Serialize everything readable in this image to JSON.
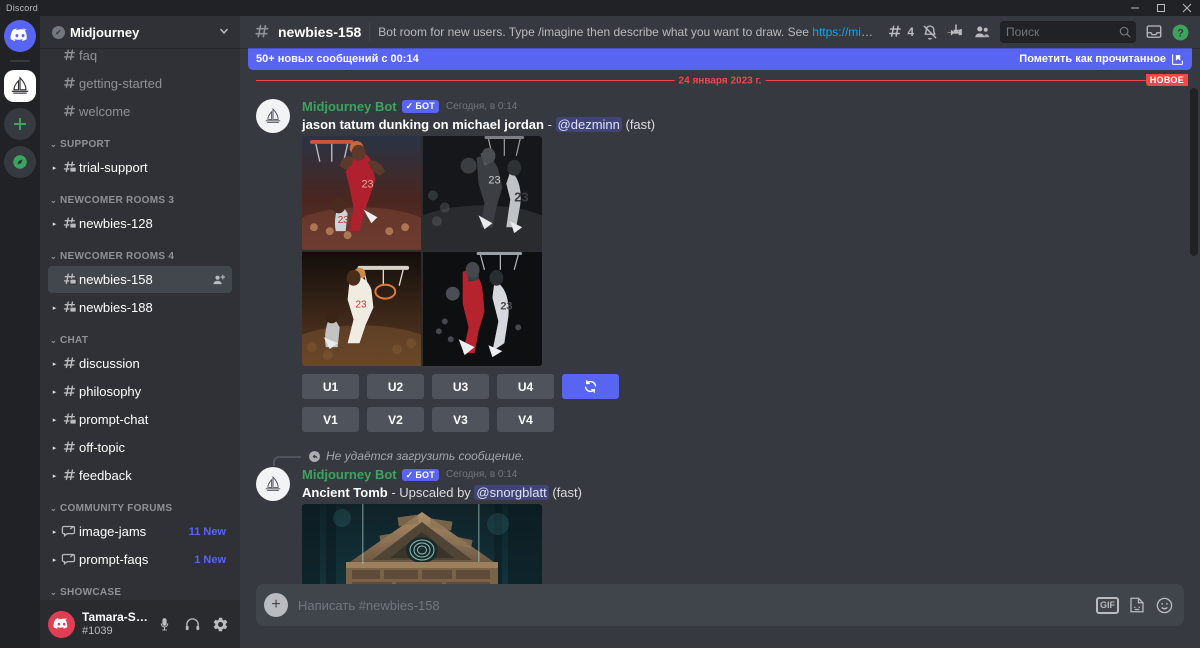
{
  "window": {
    "app_label": "Discord",
    "minimize": "—",
    "maximize": "❐",
    "close": "✕"
  },
  "colors": {
    "brand": "#5865f2",
    "online": "#3ba55d",
    "mention_red": "#f04747",
    "link": "#00a8fc",
    "bg_main": "#36393f",
    "bg_sidebar": "#2f3136",
    "bg_rail": "#202225"
  },
  "rail": {
    "items": [
      {
        "name": "home-button",
        "icon": "discord-logo-icon"
      },
      {
        "name": "guild-midjourney",
        "icon": "midjourney-sailboat-icon",
        "active": true
      },
      {
        "name": "add-server-button",
        "icon": "plus-icon"
      },
      {
        "name": "explore-servers-button",
        "icon": "compass-icon"
      }
    ]
  },
  "sidebar": {
    "guild_name": "Midjourney",
    "verified_check": "✓",
    "chevron": "⌄",
    "groups": [
      {
        "label": "",
        "show_label": false,
        "channels": [
          {
            "label": "faq",
            "icon": "hash-icon",
            "state": "partial"
          },
          {
            "label": "getting-started",
            "icon": "hash-icon",
            "state": "normal"
          },
          {
            "label": "welcome",
            "icon": "hash-icon",
            "state": "normal"
          }
        ]
      },
      {
        "label": "SUPPORT",
        "show_label": true,
        "channels": [
          {
            "label": "trial-support",
            "icon": "hash-thread-icon",
            "state": "unread",
            "caret": true
          }
        ]
      },
      {
        "label": "NEWCOMER ROOMS 3",
        "show_label": true,
        "channels": [
          {
            "label": "newbies-128",
            "icon": "hash-thread-icon",
            "state": "unread",
            "caret": true
          }
        ]
      },
      {
        "label": "NEWCOMER ROOMS 4",
        "show_label": true,
        "channels": [
          {
            "label": "newbies-158",
            "icon": "hash-thread-icon",
            "state": "active",
            "right_icon": "add-member-icon"
          },
          {
            "label": "newbies-188",
            "icon": "hash-thread-icon",
            "state": "unread",
            "caret": true
          }
        ]
      },
      {
        "label": "CHAT",
        "show_label": true,
        "channels": [
          {
            "label": "discussion",
            "icon": "hash-icon",
            "state": "unread",
            "caret": true
          },
          {
            "label": "philosophy",
            "icon": "hash-icon",
            "state": "unread",
            "caret": true
          },
          {
            "label": "prompt-chat",
            "icon": "hash-thread-icon",
            "state": "unread",
            "caret": true
          },
          {
            "label": "off-topic",
            "icon": "hash-icon",
            "state": "unread",
            "caret": true
          },
          {
            "label": "feedback",
            "icon": "hash-icon",
            "state": "unread",
            "caret": true
          }
        ]
      },
      {
        "label": "COMMUNITY FORUMS",
        "show_label": true,
        "channels": [
          {
            "label": "image-jams",
            "icon": "forum-icon",
            "state": "unread",
            "caret": true,
            "badge": "11 New"
          },
          {
            "label": "prompt-faqs",
            "icon": "forum-icon",
            "state": "unread",
            "caret": true,
            "badge": "1 New"
          }
        ]
      },
      {
        "label": "SHOWCASE",
        "show_label": true,
        "channels": []
      }
    ]
  },
  "user_panel": {
    "name": "Tamara-SS...",
    "tag": "#1039",
    "buttons": [
      {
        "name": "mute-microphone-button",
        "icon": "microphone-icon"
      },
      {
        "name": "deafen-button",
        "icon": "headphones-icon"
      },
      {
        "name": "user-settings-button",
        "icon": "gear-icon"
      }
    ]
  },
  "channel_header": {
    "title": "newbies-158",
    "topic_prefix": "Bot room for new users. Type /imagine then describe what you want to draw. See ",
    "topic_link": "https://midjourney.gitb…",
    "thread_count": "4",
    "actions": [
      {
        "name": "threads-button",
        "icon": "threads-icon"
      },
      {
        "name": "notification-settings-button",
        "icon": "bell-muted-icon"
      },
      {
        "name": "pinned-messages-button",
        "icon": "pin-icon"
      },
      {
        "name": "member-list-button",
        "icon": "members-icon"
      }
    ],
    "help_button": "help-icon",
    "inbox_button": "inbox-icon"
  },
  "search": {
    "placeholder": "Поиск",
    "value": "",
    "icon": "search-icon"
  },
  "new_messages_bar": {
    "text": "50+ новых сообщений с 00:14",
    "mark_read_label": "Пометить как прочитанное",
    "mark_read_icon": "mark-read-icon"
  },
  "date_divider": {
    "date": "24 января 2023 г.",
    "new_badge": "НОВОЕ"
  },
  "messages": [
    {
      "author": "Midjourney Bot",
      "bot_tag": "БОТ",
      "bot_tag_check": "✓",
      "timestamp": "Сегодня, в 0:14",
      "prompt": "jason tatum dunking on michael jordan",
      "separator": " - ",
      "mention": "@dezminn",
      "suffix": " (fast)",
      "grid_alt": "2x2 basketball dunk image grid",
      "upscale_buttons": [
        "U1",
        "U2",
        "U3",
        "U4"
      ],
      "reroll_button": "🔄",
      "variation_buttons": [
        "V1",
        "V2",
        "V3",
        "V4"
      ]
    },
    {
      "reply_context": "Не удаётся загрузить сообщение.",
      "author": "Midjourney Bot",
      "bot_tag": "БОТ",
      "bot_tag_check": "✓",
      "timestamp": "Сегодня, в 0:14",
      "prompt": "Ancient Tomb",
      "separator": " - Upscaled by ",
      "mention": "@snorgblatt",
      "suffix": " (fast)",
      "image_alt": "Ancient tomb stone structure in blue forest"
    }
  ],
  "composer": {
    "placeholder": "Написать #newbies-158",
    "value": "",
    "plus_icon": "plus-circle-icon",
    "gif_label": "GIF",
    "sticker_icon": "sticker-icon",
    "emoji_icon": "emoji-icon"
  }
}
